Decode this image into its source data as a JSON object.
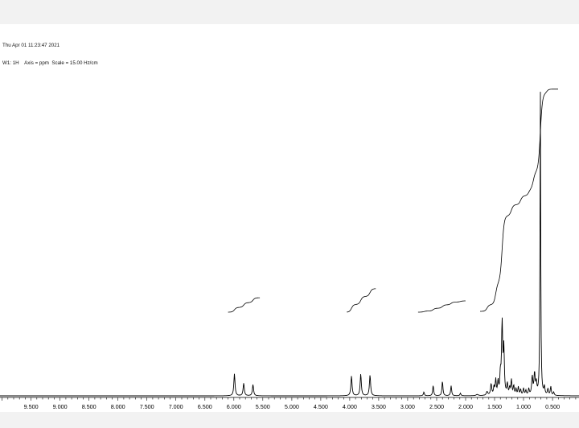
{
  "header": {
    "line1": "Thu Apr 01 11:23:47 2021",
    "line2": "W1: 1H    Axis = ppm  Scale = 15.00 Hz/cm"
  },
  "colors": {
    "trace": "#000000",
    "background": "#ffffff",
    "band": "#f2f2f2"
  },
  "chart_data": {
    "type": "line",
    "title": "",
    "xlabel": "",
    "ylabel": "",
    "x_axis": {
      "unit": "ppm",
      "reversed": true,
      "range": [
        10.0,
        0.0
      ],
      "major_ticks": [
        9.5,
        9.0,
        8.5,
        8.0,
        7.5,
        7.0,
        6.5,
        6.0,
        5.5,
        5.0,
        4.5,
        4.0,
        3.5,
        3.0,
        2.5,
        2.0,
        1.5,
        1.0,
        0.5
      ],
      "tick_labels": [
        "9.500",
        "9.000",
        "8.500",
        "8.000",
        "7.500",
        "7.000",
        "6.500",
        "6.000",
        "5.500",
        "5.000",
        "4.500",
        "4.000",
        "3.500",
        "3.000",
        "2.500",
        "2.000",
        "1.500",
        "1.000",
        "0.500"
      ],
      "minor_step": 0.1
    },
    "grid": false,
    "peaks": [
      {
        "ppm": 5.99,
        "height": 0.07,
        "width": 0.012
      },
      {
        "ppm": 5.83,
        "height": 0.04,
        "width": 0.012
      },
      {
        "ppm": 5.67,
        "height": 0.036,
        "width": 0.012
      },
      {
        "ppm": 3.97,
        "height": 0.063,
        "width": 0.012
      },
      {
        "ppm": 3.81,
        "height": 0.069,
        "width": 0.012
      },
      {
        "ppm": 3.65,
        "height": 0.066,
        "width": 0.012
      },
      {
        "ppm": 2.72,
        "height": 0.012,
        "width": 0.01
      },
      {
        "ppm": 2.56,
        "height": 0.033,
        "width": 0.01
      },
      {
        "ppm": 2.4,
        "height": 0.047,
        "width": 0.01
      },
      {
        "ppm": 2.25,
        "height": 0.032,
        "width": 0.01
      },
      {
        "ppm": 2.09,
        "height": 0.008,
        "width": 0.01
      },
      {
        "ppm": 1.8,
        "height": 0.004,
        "width": 0.02
      },
      {
        "ppm": 1.63,
        "height": 0.012,
        "width": 0.015
      },
      {
        "ppm": 1.56,
        "height": 0.036,
        "width": 0.012
      },
      {
        "ppm": 1.51,
        "height": 0.026,
        "width": 0.01
      },
      {
        "ppm": 1.48,
        "height": 0.048,
        "width": 0.01
      },
      {
        "ppm": 1.44,
        "height": 0.042,
        "width": 0.01
      },
      {
        "ppm": 1.4,
        "height": 0.06,
        "width": 0.01
      },
      {
        "ppm": 1.37,
        "height": 0.23,
        "width": 0.012
      },
      {
        "ppm": 1.34,
        "height": 0.14,
        "width": 0.01
      },
      {
        "ppm": 1.28,
        "height": 0.035,
        "width": 0.01
      },
      {
        "ppm": 1.24,
        "height": 0.022,
        "width": 0.01
      },
      {
        "ppm": 1.21,
        "height": 0.048,
        "width": 0.01
      },
      {
        "ppm": 1.17,
        "height": 0.03,
        "width": 0.01
      },
      {
        "ppm": 1.13,
        "height": 0.02,
        "width": 0.01
      },
      {
        "ppm": 1.09,
        "height": 0.026,
        "width": 0.01
      },
      {
        "ppm": 1.05,
        "height": 0.018,
        "width": 0.01
      },
      {
        "ppm": 1.0,
        "height": 0.022,
        "width": 0.01
      },
      {
        "ppm": 0.96,
        "height": 0.015,
        "width": 0.01
      },
      {
        "ppm": 0.91,
        "height": 0.02,
        "width": 0.01
      },
      {
        "ppm": 0.85,
        "height": 0.058,
        "width": 0.012
      },
      {
        "ppm": 0.81,
        "height": 0.068,
        "width": 0.012
      },
      {
        "ppm": 0.78,
        "height": 0.035,
        "width": 0.01
      },
      {
        "ppm": 0.71,
        "height": 0.98,
        "width": 0.007
      },
      {
        "ppm": 0.64,
        "height": 0.025,
        "width": 0.01
      },
      {
        "ppm": 0.58,
        "height": 0.02,
        "width": 0.01
      },
      {
        "ppm": 0.53,
        "height": 0.028,
        "width": 0.01
      },
      {
        "ppm": 0.48,
        "height": 0.01,
        "width": 0.01
      }
    ],
    "integrals": [
      {
        "from": 6.1,
        "to": 5.55,
        "steps": [
          [
            5.99,
            0.33
          ],
          [
            5.83,
            0.33
          ],
          [
            5.67,
            0.34
          ]
        ],
        "rise": 0.046
      },
      {
        "from": 4.05,
        "to": 3.55,
        "steps": [
          [
            3.97,
            0.33
          ],
          [
            3.81,
            0.34
          ],
          [
            3.65,
            0.33
          ]
        ],
        "rise": 0.075
      },
      {
        "from": 2.82,
        "to": 2.0,
        "steps": [
          [
            2.72,
            0.1
          ],
          [
            2.56,
            0.25
          ],
          [
            2.4,
            0.3
          ],
          [
            2.25,
            0.25
          ],
          [
            2.09,
            0.1
          ]
        ],
        "rise": 0.036
      },
      {
        "from": 1.75,
        "to": 0.4,
        "steps": [
          [
            1.63,
            0.03
          ],
          [
            1.48,
            0.1
          ],
          [
            1.37,
            0.3
          ],
          [
            1.21,
            0.05
          ],
          [
            1.05,
            0.04
          ],
          [
            0.91,
            0.03
          ],
          [
            0.83,
            0.08
          ],
          [
            0.71,
            0.35
          ],
          [
            0.6,
            0.02
          ]
        ],
        "rise": 0.71
      }
    ]
  }
}
